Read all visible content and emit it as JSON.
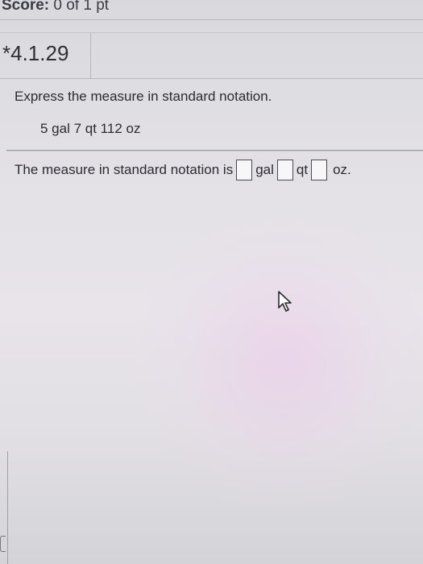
{
  "header": {
    "score_label": "Score:",
    "score_value": "0 of 1 pt"
  },
  "question": {
    "number": "*4.1.29",
    "prompt": "Express the measure in standard notation.",
    "measure": "5 gal 7 qt 112 oz"
  },
  "answer": {
    "lead_text": "The measure in standard notation is",
    "units": [
      "gal",
      "qt",
      "oz."
    ],
    "values": [
      "",
      "",
      ""
    ]
  }
}
